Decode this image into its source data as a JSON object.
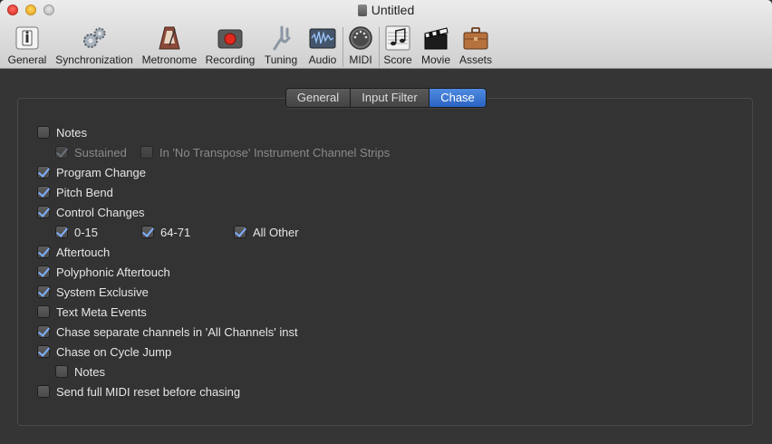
{
  "window": {
    "title": "Untitled"
  },
  "toolbar": {
    "items": [
      {
        "label": "General",
        "icon": "general-icon"
      },
      {
        "label": "Synchronization",
        "icon": "gears-icon"
      },
      {
        "label": "Metronome",
        "icon": "metronome-icon"
      },
      {
        "label": "Recording",
        "icon": "record-icon"
      },
      {
        "label": "Tuning",
        "icon": "tuning-fork-icon"
      },
      {
        "label": "Audio",
        "icon": "audio-waveform-icon"
      },
      {
        "label": "MIDI",
        "icon": "midi-connector-icon"
      },
      {
        "label": "Score",
        "icon": "score-notes-icon"
      },
      {
        "label": "Movie",
        "icon": "clapperboard-icon"
      },
      {
        "label": "Assets",
        "icon": "briefcase-icon"
      }
    ]
  },
  "tabs": {
    "items": [
      "General",
      "Input Filter",
      "Chase"
    ],
    "selected": "Chase"
  },
  "chase": {
    "notes": {
      "label": "Notes",
      "checked": false
    },
    "sustained": {
      "label": "Sustained",
      "checked": true,
      "enabled": false
    },
    "no_transpose": {
      "label": "In 'No Transpose' Instrument Channel Strips",
      "checked": false,
      "enabled": false
    },
    "program_change": {
      "label": "Program Change",
      "checked": true
    },
    "pitch_bend": {
      "label": "Pitch Bend",
      "checked": true
    },
    "control_changes": {
      "label": "Control Changes",
      "checked": true
    },
    "cc_0_15": {
      "label": "0-15",
      "checked": true
    },
    "cc_64_71": {
      "label": "64-71",
      "checked": true
    },
    "cc_all_other": {
      "label": "All Other",
      "checked": true
    },
    "aftertouch": {
      "label": "Aftertouch",
      "checked": true
    },
    "poly_aftertouch": {
      "label": "Polyphonic Aftertouch",
      "checked": true
    },
    "system_exclusive": {
      "label": "System Exclusive",
      "checked": true
    },
    "text_meta": {
      "label": "Text Meta Events",
      "checked": false
    },
    "separate_channels": {
      "label": "Chase separate channels in 'All Channels' inst",
      "checked": true
    },
    "cycle_jump": {
      "label": "Chase on Cycle Jump",
      "checked": true
    },
    "cycle_notes": {
      "label": "Notes",
      "checked": false
    },
    "midi_reset": {
      "label": "Send full MIDI reset before chasing",
      "checked": false
    }
  },
  "colors": {
    "accent": "#2a63c2",
    "check": "#7fb0ff"
  }
}
